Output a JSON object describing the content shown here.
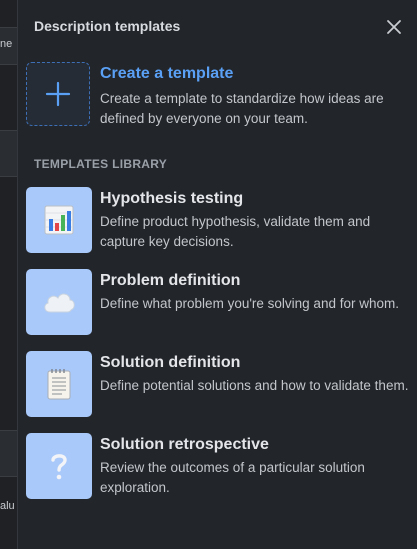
{
  "background": {
    "fragments": [
      "ne",
      "alu"
    ]
  },
  "panel": {
    "title": "Description templates",
    "close_icon": "close-icon",
    "create": {
      "title": "Create a template",
      "description": "Create a template to standardize how ideas are defined by everyone on your team.",
      "icon": "plus-icon"
    },
    "library_label": "TEMPLATES LIBRARY",
    "templates": [
      {
        "title": "Hypothesis testing",
        "description": "Define product hypothesis, validate them and capture key decisions.",
        "icon": "bar-chart-icon"
      },
      {
        "title": "Problem definition",
        "description": "Define what problem you're solving and for whom.",
        "icon": "cloud-icon"
      },
      {
        "title": "Solution definition",
        "description": "Define potential solutions and how to validate them.",
        "icon": "notepad-icon"
      },
      {
        "title": "Solution retrospective",
        "description": "Review the outcomes of a particular solution exploration.",
        "icon": "question-mark-icon"
      }
    ]
  },
  "colors": {
    "accent": "#5aa0f5",
    "tile_bg": "#a9c9fa",
    "panel_bg": "#22252a"
  }
}
